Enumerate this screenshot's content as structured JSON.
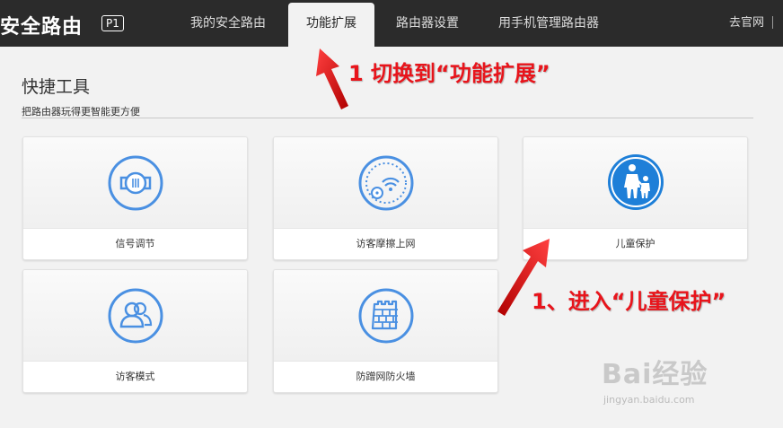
{
  "header": {
    "brand": "安全路由",
    "model": "P1",
    "tabs": [
      {
        "label": "我的安全路由",
        "active": false
      },
      {
        "label": "功能扩展",
        "active": true
      },
      {
        "label": "路由器设置",
        "active": false
      },
      {
        "label": "用手机管理路由器",
        "active": false
      }
    ],
    "official_site": "去官网"
  },
  "section": {
    "title": "快捷工具",
    "subtitle": "把路由器玩得更智能更方便"
  },
  "tools": [
    {
      "label": "信号调节",
      "icon": "signal-adjust-icon"
    },
    {
      "label": "访客摩擦上网",
      "icon": "guest-wifi-icon"
    },
    {
      "label": "儿童保护",
      "icon": "child-protection-icon"
    },
    {
      "label": "访客模式",
      "icon": "guest-mode-icon"
    },
    {
      "label": "防蹭网防火墙",
      "icon": "firewall-icon"
    }
  ],
  "annotations": {
    "step1": "1 切换到“功能扩展”",
    "step2": "1、进入“儿童保护”"
  },
  "watermark": {
    "logo": "Bai经验",
    "url": "jingyan.baidu.com"
  },
  "colors": {
    "accent": "#4a90e2",
    "child_icon": "#1e7fd8",
    "annotation": "#e8141b",
    "topbar": "#2b2b2b"
  }
}
